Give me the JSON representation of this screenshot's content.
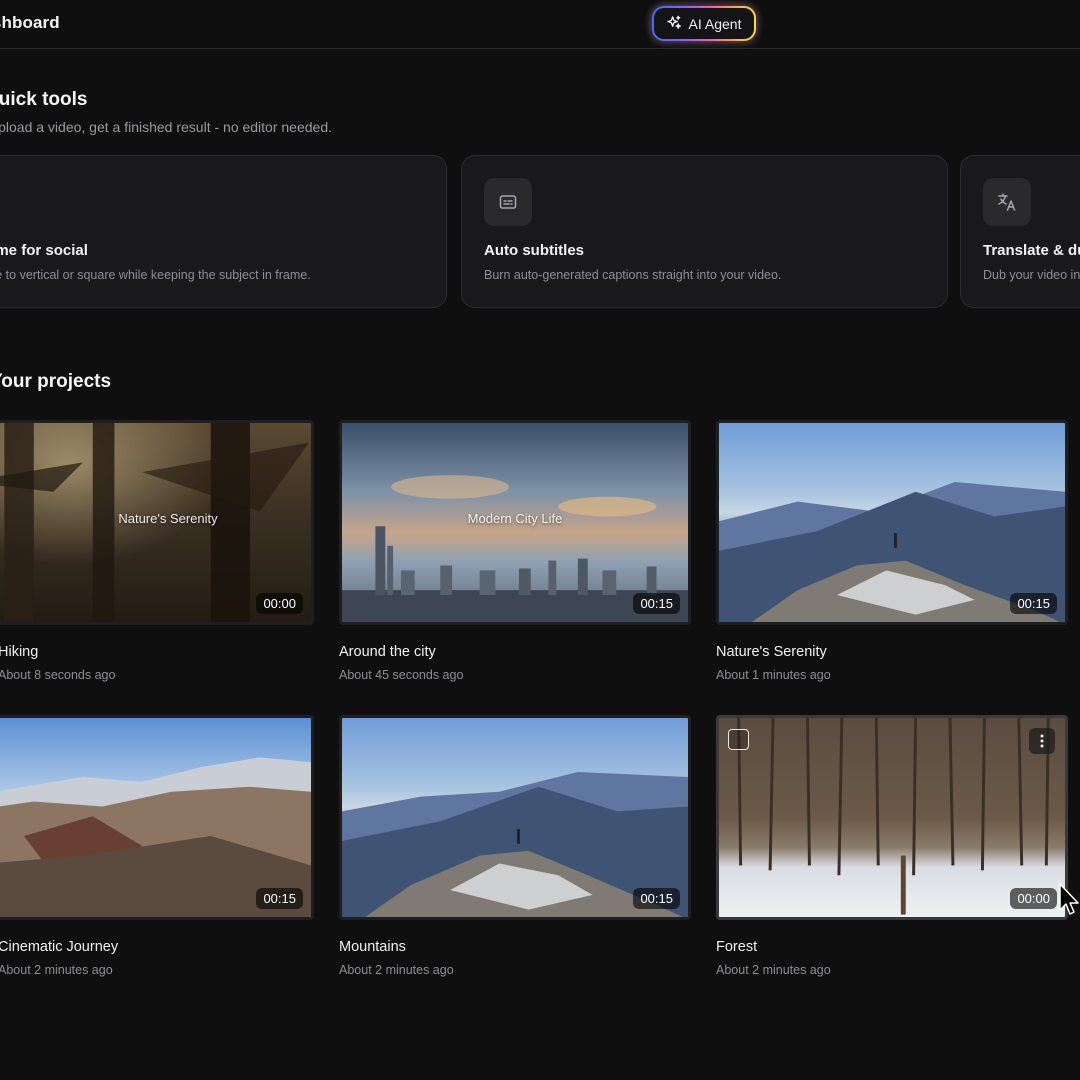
{
  "header": {
    "title": "Dashboard",
    "agent_button": "AI Agent"
  },
  "quick_tools": {
    "heading": "Quick tools",
    "subheading": "Upload a video, get a finished result - no editor needed.",
    "tools": [
      {
        "title": "Reframe for social",
        "description": "Resize to vertical or square while keeping the subject in frame.",
        "icon": "reframe-icon"
      },
      {
        "title": "Auto subtitles",
        "description": "Burn auto-generated captions straight into your video.",
        "icon": "subtitles-icon"
      },
      {
        "title": "Translate & dub",
        "description": "Dub your video in",
        "icon": "translate-icon"
      }
    ]
  },
  "projects": {
    "heading": "Your projects",
    "items": [
      {
        "title": "Hiking",
        "time": "About 8 seconds ago",
        "overlay": "Nature's Serenity",
        "duration": "00:00"
      },
      {
        "title": "Around the city",
        "time": "About 45 seconds ago",
        "overlay": "Modern City Life",
        "duration": "00:15"
      },
      {
        "title": "Nature's Serenity",
        "time": "About 1 minutes ago",
        "overlay": "",
        "duration": "00:15"
      },
      {
        "title": "Cinematic Journey",
        "time": "About 2 minutes ago",
        "overlay": "",
        "duration": "00:15"
      },
      {
        "title": "Mountains",
        "time": "About 2 minutes ago",
        "overlay": "",
        "duration": "00:15"
      },
      {
        "title": "Forest",
        "time": "About 2 minutes ago",
        "overlay": "",
        "duration": "00:00"
      }
    ]
  },
  "colors": {
    "background": "#0f0f10",
    "card": "#19191b",
    "accent_green": "#a6f03a"
  }
}
